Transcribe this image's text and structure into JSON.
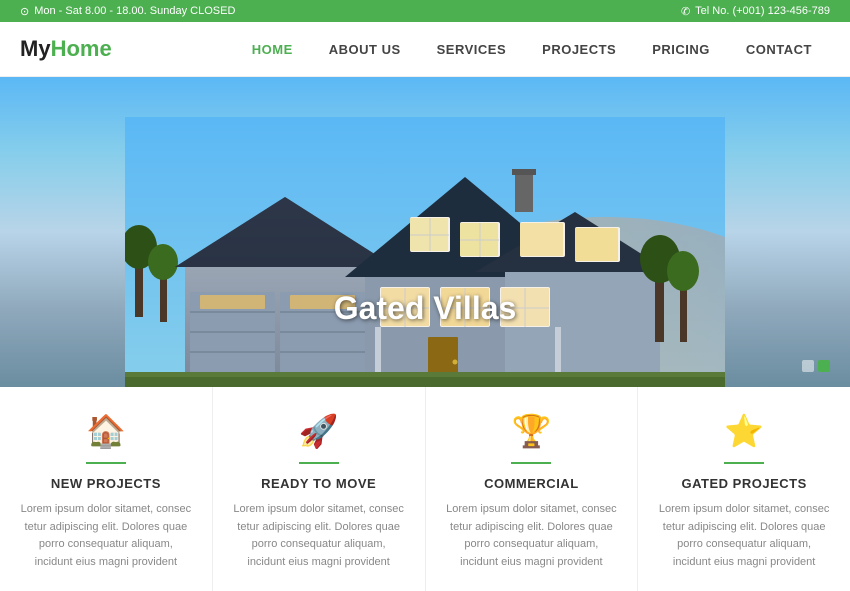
{
  "topbar": {
    "hours": "Mon - Sat 8.00 - 18.00. Sunday CLOSED",
    "phone": "Tel No. (+001) 123-456-789",
    "clock_icon": "⊙",
    "phone_icon": "✆"
  },
  "header": {
    "logo_my": "My",
    "logo_home": "Home",
    "nav": [
      {
        "label": "HOME",
        "active": true
      },
      {
        "label": "ABOUT US",
        "active": false
      },
      {
        "label": "SERVICES",
        "active": false
      },
      {
        "label": "PROJECTS",
        "active": false
      },
      {
        "label": "PRICING",
        "active": false
      },
      {
        "label": "CONTACT",
        "active": false
      }
    ]
  },
  "hero": {
    "title": "Gated Villas",
    "dots": [
      false,
      true
    ]
  },
  "cards": [
    {
      "icon": "🏠",
      "title": "NEW PROJECTS",
      "text": "Lorem ipsum dolor sitamet, consec tetur adipiscing elit. Dolores quae porro consequatur aliquam, incidunt eius magni provident"
    },
    {
      "icon": "🚀",
      "title": "READY TO MOVE",
      "text": "Lorem ipsum dolor sitamet, consec tetur adipiscing elit. Dolores quae porro consequatur aliquam, incidunt eius magni provident"
    },
    {
      "icon": "🏆",
      "title": "COMMERCIAL",
      "text": "Lorem ipsum dolor sitamet, consec tetur adipiscing elit. Dolores quae porro consequatur aliquam, incidunt eius magni provident"
    },
    {
      "icon": "⭐",
      "title": "GATED PROJECTS",
      "text": "Lorem ipsum dolor sitamet, consec tetur adipiscing elit. Dolores quae porro consequatur aliquam, incidunt eius magni provident"
    }
  ],
  "colors": {
    "green": "#4CAF50",
    "dark": "#222222",
    "text_gray": "#888888"
  }
}
